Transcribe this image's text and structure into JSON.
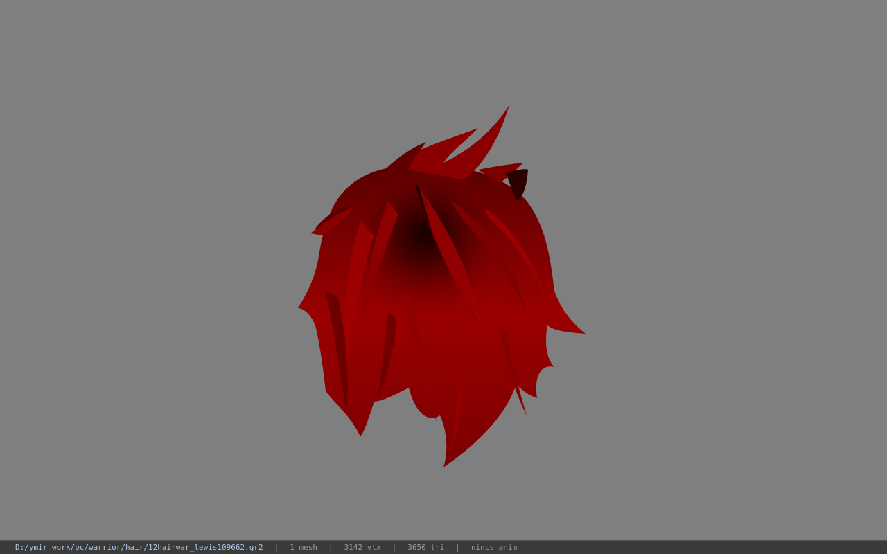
{
  "viewport": {
    "background": "#7f7f7f",
    "model": {
      "name": "hair-model",
      "color": "#8c0000",
      "shadow_color": "#1a0000"
    }
  },
  "statusbar": {
    "file_path": "D:/ymir work/pc/warrior/hair/12hairwar_lewis109662.gr2",
    "separator": "|",
    "mesh_count": "1 mesh",
    "vertex_count": "3142 vtx",
    "triangle_count": "3650 tri",
    "anim_status": "nincs anim"
  }
}
